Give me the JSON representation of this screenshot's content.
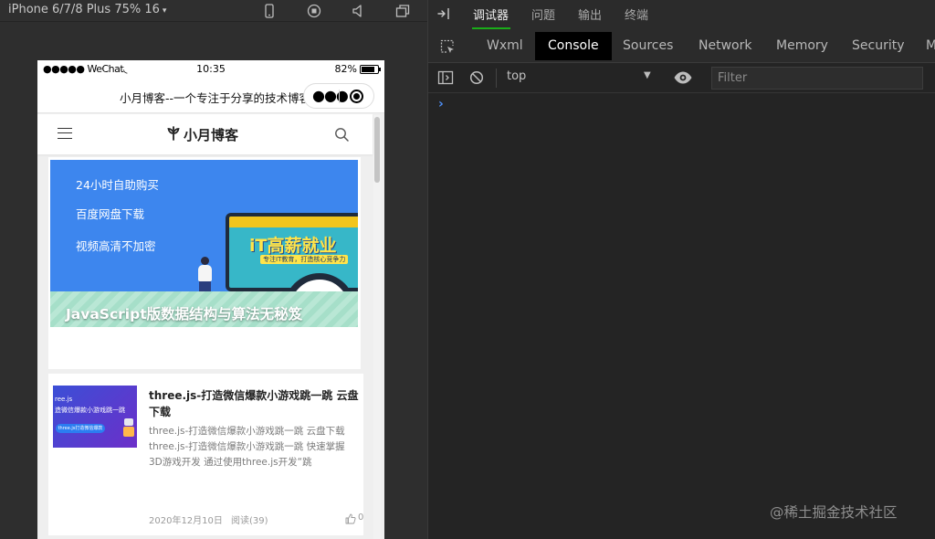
{
  "simulator": {
    "device_label": "iPhone 6/7/8 Plus 75% 16",
    "device_caret": "▾",
    "toolbar_icons": [
      "phone-icon",
      "record-icon",
      "volume-icon",
      "window-icon"
    ],
    "status_bar": {
      "carrier": "●●●●● WeChat",
      "wifi_glyph": "◟",
      "time": "10:35",
      "battery": "82%",
      "battery_level": 0.82
    },
    "nav_bar": {
      "title": "小月博客--一个专注于分享的技术博客",
      "more_glyph": "●●●"
    },
    "blog_header": {
      "name": "小月博客"
    },
    "banner": {
      "lines": [
        "24小时自助购买",
        "百度网盘下载",
        "视频高清不加密"
      ],
      "screen_heading": "iT高薪就业",
      "screen_sub": "专注IT教育，打造核心竞争力",
      "caption": "JavaScript版数据结构与算法无秘笈"
    },
    "post": {
      "thumb_line1": "ree.js",
      "thumb_line2": "造微信爆款小游戏跳一跳",
      "thumb_button": "three.js打造微信爆款",
      "title": "three.js-打造微信爆款小游戏跳一跳 云盘下载",
      "excerpt": "three.js-打造微信爆款小游戏跳一跳 云盘下载 three.js-打造微信爆款小游戏跳一跳 快速掌握 3D游戏开发 通过使用three.js开发“跳",
      "date": "2020年12月10日",
      "views": "阅读(39)",
      "likes": "0"
    }
  },
  "devtools": {
    "top_tabs": [
      {
        "label": "调试器",
        "active": true
      },
      {
        "label": "问题",
        "active": false
      },
      {
        "label": "输出",
        "active": false
      },
      {
        "label": "终端",
        "active": false
      }
    ],
    "panel_tabs": [
      {
        "label": "Wxml",
        "active": false
      },
      {
        "label": "Console",
        "active": true
      },
      {
        "label": "Sources",
        "active": false
      },
      {
        "label": "Network",
        "active": false
      },
      {
        "label": "Memory",
        "active": false
      },
      {
        "label": "Security",
        "active": false
      },
      {
        "label": "M",
        "active": false
      }
    ],
    "console": {
      "context": "top",
      "context_caret": "▼",
      "filter_placeholder": "Filter",
      "prompt": "›"
    },
    "accent_color": "#1aad19"
  },
  "watermark": "@稀土掘金技术社区"
}
